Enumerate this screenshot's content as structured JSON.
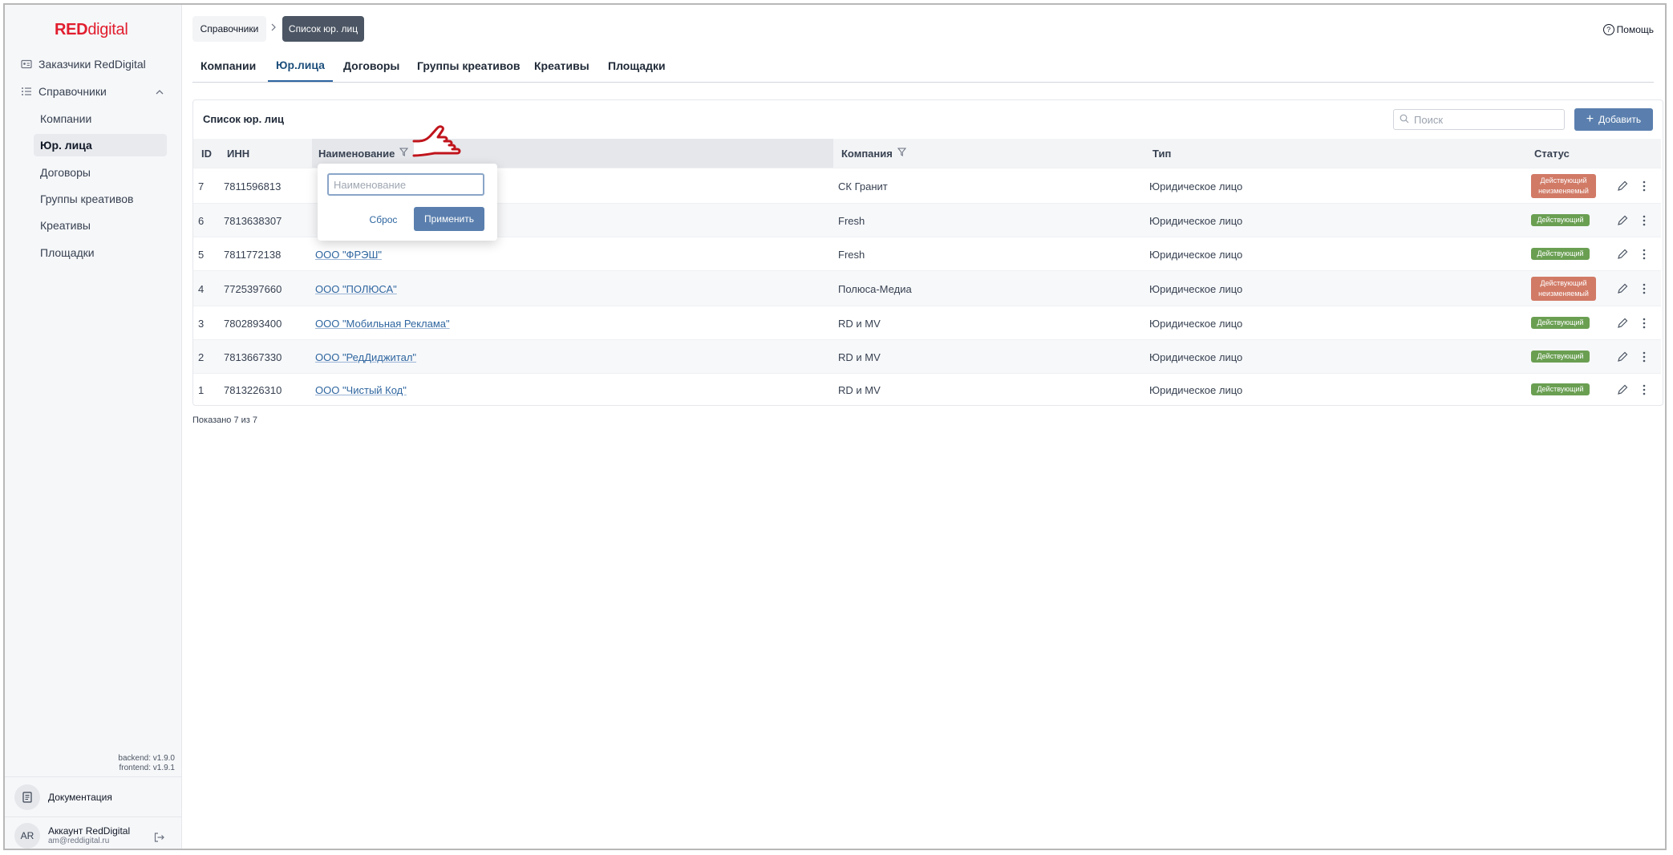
{
  "logo": {
    "bold": "RED",
    "rest": "digital"
  },
  "sidebar": {
    "customers": "Заказчики RedDigital",
    "references": "Справочники",
    "sub_items": [
      "Компании",
      "Юр. лица",
      "Договоры",
      "Группы креативов",
      "Креативы",
      "Площадки"
    ],
    "active_index": 1,
    "versions": {
      "backend": "backend: v1.9.0",
      "frontend": "frontend: v1.9.1"
    },
    "docs": "Документация",
    "account": {
      "initials": "AR",
      "name": "Аккаунт RedDigital",
      "email": "am@reddigital.ru"
    }
  },
  "breadcrumb": {
    "root": "Справочники",
    "current": "Список юр. лиц"
  },
  "help": "Помощь",
  "tabs": [
    "Компании",
    "Юр.лица",
    "Договоры",
    "Группы креативов",
    "Креативы",
    "Площадки"
  ],
  "active_tab": 1,
  "card": {
    "title": "Список юр. лиц",
    "search_placeholder": "Поиск",
    "add_label": "Добавить",
    "columns": {
      "id": "ID",
      "inn": "ИНН",
      "name": "Наименование",
      "company": "Компания",
      "type": "Тип",
      "status": "Статус"
    },
    "rows": [
      {
        "id": "7",
        "inn": "7811596813",
        "name": "",
        "company": "СК Гранит",
        "type": "Юридическое лицо",
        "status_l1": "Действующий",
        "status_l2": "неизменяемый",
        "status_color": "#d17a66"
      },
      {
        "id": "6",
        "inn": "7813638307",
        "name": "",
        "company": "Fresh",
        "type": "Юридическое лицо",
        "status_l1": "Действующий",
        "status_l2": "",
        "status_color": "#6a9f52"
      },
      {
        "id": "5",
        "inn": "7811772138",
        "name": "ООО \"ФРЭШ\"",
        "company": "Fresh",
        "type": "Юридическое лицо",
        "status_l1": "Действующий",
        "status_l2": "",
        "status_color": "#6a9f52"
      },
      {
        "id": "4",
        "inn": "7725397660",
        "name": "ООО \"ПОЛЮСА\"",
        "company": "Полюса-Медиа",
        "type": "Юридическое лицо",
        "status_l1": "Действующий",
        "status_l2": "неизменяемый",
        "status_color": "#d17a66"
      },
      {
        "id": "3",
        "inn": "7802893400",
        "name": "ООО \"Мобильная Реклама\"",
        "company": "RD и MV",
        "type": "Юридическое лицо",
        "status_l1": "Действующий",
        "status_l2": "",
        "status_color": "#6a9f52"
      },
      {
        "id": "2",
        "inn": "7813667330",
        "name": "ООО \"РедДиджитал\"",
        "company": "RD и MV",
        "type": "Юридическое лицо",
        "status_l1": "Действующий",
        "status_l2": "",
        "status_color": "#6a9f52"
      },
      {
        "id": "1",
        "inn": "7813226310",
        "name": "ООО \"Чистый Код\"",
        "company": "RD и MV",
        "type": "Юридическое лицо",
        "status_l1": "Действующий",
        "status_l2": "",
        "status_color": "#6a9f52"
      }
    ],
    "shown": "Показано 7 из 7"
  },
  "filter_popover": {
    "placeholder": "Наименование",
    "value": "",
    "reset": "Сброс",
    "apply": "Применить"
  },
  "colors": {
    "accent": "#5a7fae",
    "link": "#2f66a0",
    "active_status": "#6a9f52",
    "locked_status": "#d17a66",
    "logo": "#e11d2e"
  }
}
